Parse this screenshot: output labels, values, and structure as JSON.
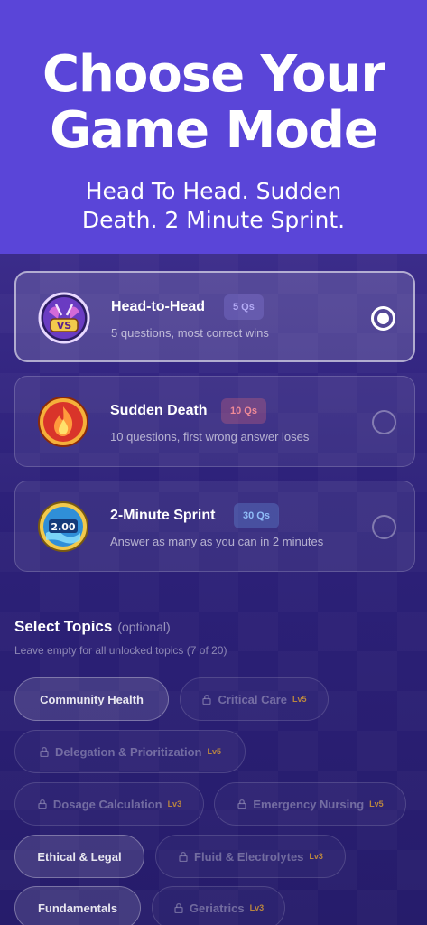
{
  "hero": {
    "title": "Choose Your\nGame Mode",
    "subtitle": "Head To Head. Sudden\nDeath. 2 Minute Sprint."
  },
  "modes": [
    {
      "name": "Head-to-Head",
      "badge": "5 Qs",
      "description": "5 questions, most correct wins",
      "icon": "vs-icon",
      "selected": true,
      "badge_color": "#8f86e6"
    },
    {
      "name": "Sudden Death",
      "badge": "10 Qs",
      "description": "10 questions, first wrong answer loses",
      "icon": "fire-icon",
      "selected": false,
      "badge_color": "#e86b7a"
    },
    {
      "name": "2-Minute Sprint",
      "badge": "30 Qs",
      "description": "Answer as many as you can in 2 minutes",
      "icon": "timer-icon",
      "icon_text": "2.00",
      "selected": false,
      "badge_color": "#6fa4f0"
    }
  ],
  "topics": {
    "title": "Select Topics",
    "optional_label": "(optional)",
    "hint": "Leave empty for all unlocked topics (7 of 20)",
    "chips": [
      {
        "label": "Community Health",
        "locked": false
      },
      {
        "label": "Critical Care",
        "locked": true,
        "level": "Lv5"
      },
      {
        "label": "Delegation & Prioritization",
        "locked": true,
        "level": "Lv5"
      },
      {
        "label": "Dosage Calculation",
        "locked": true,
        "level": "Lv3"
      },
      {
        "label": "Emergency Nursing",
        "locked": true,
        "level": "Lv5"
      },
      {
        "label": "Ethical & Legal",
        "locked": false
      },
      {
        "label": "Fluid & Electrolytes",
        "locked": true,
        "level": "Lv3"
      },
      {
        "label": "Fundamentals",
        "locked": false
      },
      {
        "label": "Geriatrics",
        "locked": true,
        "level": "Lv3"
      }
    ]
  },
  "colors": {
    "hero": "#5a45d8",
    "background": "#2a1f6e",
    "level": "#c9913a"
  }
}
